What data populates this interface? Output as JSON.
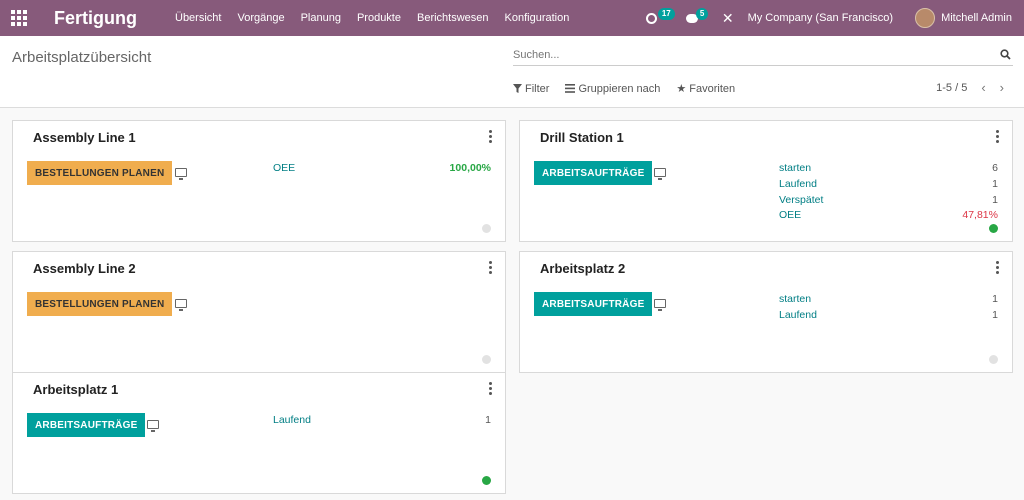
{
  "navbar": {
    "brand": "Fertigung",
    "menu": [
      "Übersicht",
      "Vorgänge",
      "Planung",
      "Produkte",
      "Berichtswesen",
      "Konfiguration"
    ],
    "activity_count": "17",
    "messages_count": "5",
    "company": "My Company (San Francisco)",
    "user": "Mitchell Admin"
  },
  "control": {
    "breadcrumb": "Arbeitsplatzübersicht",
    "search_placeholder": "Suchen...",
    "filter_label": "Filter",
    "group_label": "Gruppieren nach",
    "favorites_label": "Favoriten",
    "pager": "1-5 / 5"
  },
  "cards": [
    {
      "title": "Assembly Line 1",
      "button": "BESTELLUNGEN PLANEN",
      "stats": [
        {
          "label": "OEE",
          "value": "100,00%"
        }
      ]
    },
    {
      "title": "Drill Station 1",
      "button": "ARBEITSAUFTRÄGE",
      "stats": [
        {
          "label": "starten",
          "value": "6"
        },
        {
          "label": "Laufend",
          "value": "1"
        },
        {
          "label": "Verspätet",
          "value": "1"
        },
        {
          "label": "OEE",
          "value": "47,81%"
        }
      ]
    },
    {
      "title": "Assembly Line 2",
      "button": "BESTELLUNGEN PLANEN",
      "stats": []
    },
    {
      "title": "Arbeitsplatz 2",
      "button": "ARBEITSAUFTRÄGE",
      "stats": [
        {
          "label": "starten",
          "value": "1"
        },
        {
          "label": "Laufend",
          "value": "1"
        }
      ]
    },
    {
      "title": "Arbeitsplatz 1",
      "button": "ARBEITSAUFTRÄGE",
      "stats": [
        {
          "label": "Laufend",
          "value": "1"
        }
      ]
    }
  ]
}
